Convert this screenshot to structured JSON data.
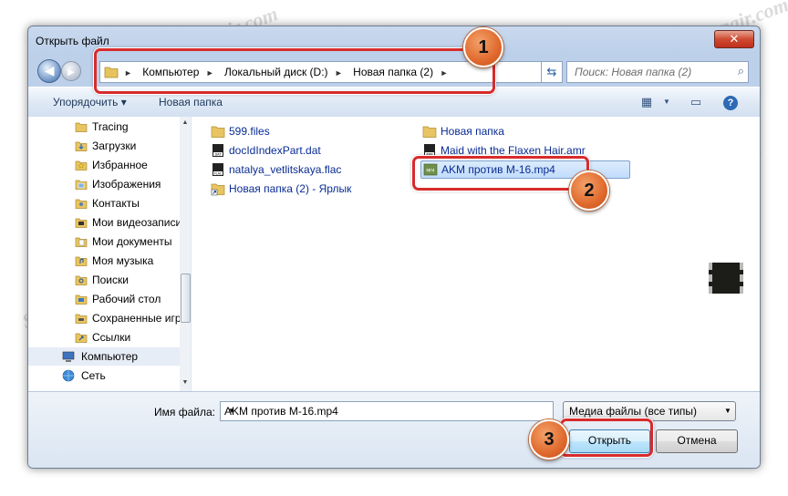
{
  "window": {
    "title": "Открыть файл",
    "close_glyph": "✕"
  },
  "address": {
    "crumbs": [
      "Компьютер",
      "Локальный диск (D:)",
      "Новая папка (2)"
    ],
    "arrow": "►"
  },
  "search": {
    "placeholder": "Поиск: Новая папка (2)"
  },
  "toolbar": {
    "organize": "Упорядочить ▾",
    "new_folder": "Новая папка"
  },
  "nav": {
    "items": [
      {
        "label": "Tracing",
        "icon": "folder-icon"
      },
      {
        "label": "Загрузки",
        "icon": "downloads-icon"
      },
      {
        "label": "Избранное",
        "icon": "favorites-icon"
      },
      {
        "label": "Изображения",
        "icon": "pictures-icon"
      },
      {
        "label": "Контакты",
        "icon": "contacts-icon"
      },
      {
        "label": "Мои видеозаписи",
        "icon": "videos-icon"
      },
      {
        "label": "Мои документы",
        "icon": "documents-icon"
      },
      {
        "label": "Моя музыка",
        "icon": "music-icon"
      },
      {
        "label": "Поиски",
        "icon": "searches-icon"
      },
      {
        "label": "Рабочий стол",
        "icon": "desktop-icon"
      },
      {
        "label": "Сохраненные игры",
        "icon": "saved-games-icon"
      },
      {
        "label": "Ссылки",
        "icon": "links-icon"
      },
      {
        "label": "Компьютер",
        "icon": "computer-icon"
      },
      {
        "label": "Сеть",
        "icon": "network-icon"
      }
    ]
  },
  "files": {
    "left": [
      {
        "label": "599.files",
        "icon": "folder-icon"
      },
      {
        "label": "docIdIndexPart.dat",
        "icon": "dat-file-icon"
      },
      {
        "label": "natalya_vetlitskaya.flac",
        "icon": "flac-file-icon"
      },
      {
        "label": "Новая папка (2) - Ярлык",
        "icon": "shortcut-icon"
      }
    ],
    "right": [
      {
        "label": "Новая папка",
        "icon": "folder-icon"
      },
      {
        "label": "Maid with the Flaxen Hair.amr",
        "icon": "amr-file-icon"
      },
      {
        "label": "AKM против M-16.mp4",
        "icon": "mp4-file-icon"
      }
    ]
  },
  "bottom": {
    "filename_label": "Имя файла:",
    "filename_value": "AKM против M-16.mp4",
    "filter_value": "Медиа файлы (все типы)",
    "open_label": "Открыть",
    "cancel_label": "Отмена"
  },
  "badges": [
    "1",
    "2",
    "3"
  ],
  "watermark": "Soringpcrepair.com",
  "colors": {
    "highlight": "#d82b2b",
    "badge": "#e0692d",
    "link_text": "#0a2c94"
  }
}
